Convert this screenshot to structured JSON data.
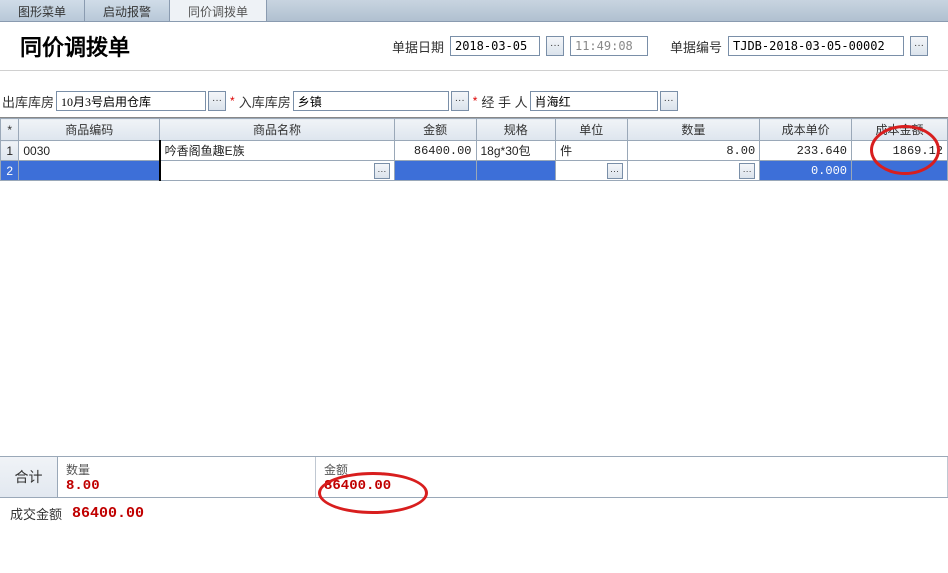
{
  "tabs": [
    {
      "label": "图形菜单"
    },
    {
      "label": "启动报警"
    },
    {
      "label": "同价调拨单"
    }
  ],
  "title": "同价调拨单",
  "header": {
    "date_label": "单据日期",
    "date_value": "2018-03-05",
    "time_value": "11:49:08",
    "docno_label": "单据编号",
    "docno_value": "TJDB-2018-03-05-00002"
  },
  "filters": {
    "out_label": "出库库房",
    "out_value": "10月3号启用仓库",
    "in_label": "入库库房",
    "in_value": "乡镇",
    "handler_label": "经 手 人",
    "handler_value": "肖海红"
  },
  "columns": {
    "star": "*",
    "code": "商品编码",
    "name": "商品名称",
    "amount": "金额",
    "spec": "规格",
    "unit": "单位",
    "qty": "数量",
    "cost_price": "成本单价",
    "cost_amount": "成本金额"
  },
  "rows": [
    {
      "num": "1",
      "code": "0030",
      "name": "吟香阁鱼趣E族",
      "amount": "86400.00",
      "spec": "18g*30包",
      "unit": "件",
      "qty": "8.00",
      "cost_price": "233.640",
      "cost_amount": "1869.12"
    },
    {
      "num": "2",
      "code": "",
      "name": "",
      "amount": "",
      "spec": "",
      "unit": "",
      "qty": "",
      "cost_price": "0.000",
      "cost_amount": ""
    }
  ],
  "summary": {
    "label": "合计",
    "qty_label": "数量",
    "qty_value": "8.00",
    "amount_label": "金额",
    "amount_value": "86400.00"
  },
  "bottom": {
    "deal_label": "成交金额",
    "deal_value": "86400.00"
  },
  "ellipsis": "···"
}
